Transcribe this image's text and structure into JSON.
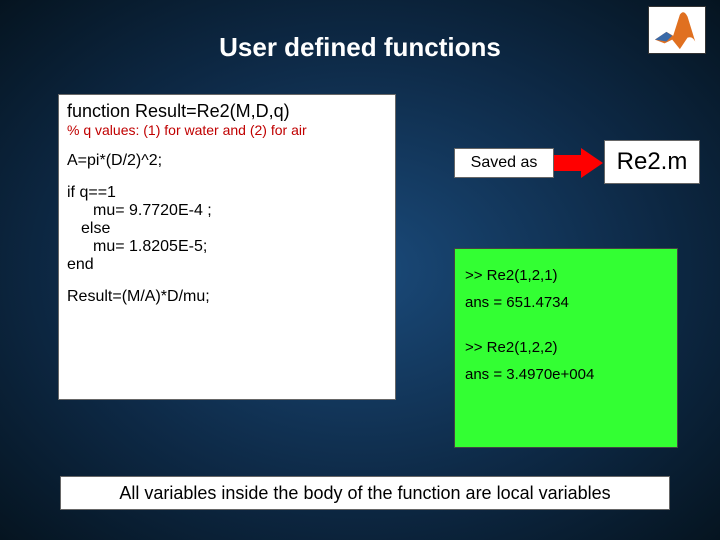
{
  "title": "User defined functions",
  "code": {
    "signature": "function Result=Re2(M,D,q)",
    "comment": "% q values: (1) for water and (2) for air",
    "line_A": "A=pi*(D/2)^2;",
    "if_line": "if q==1",
    "mu_water": "mu= 9.7720E-4 ;",
    "else_line": "else",
    "mu_air": "mu= 1.8205E-5;",
    "end_line": "end",
    "result_line": "Result=(M/A)*D/mu;"
  },
  "saved_as_label": "Saved as",
  "filename": "Re2.m",
  "output": {
    "call1": ">> Re2(1,2,1)",
    "ans1": "ans =  651.4734",
    "call2": ">> Re2(1,2,2)",
    "ans2": "ans =  3.4970e+004"
  },
  "footer_note": "All variables inside the body of the function are local variables"
}
